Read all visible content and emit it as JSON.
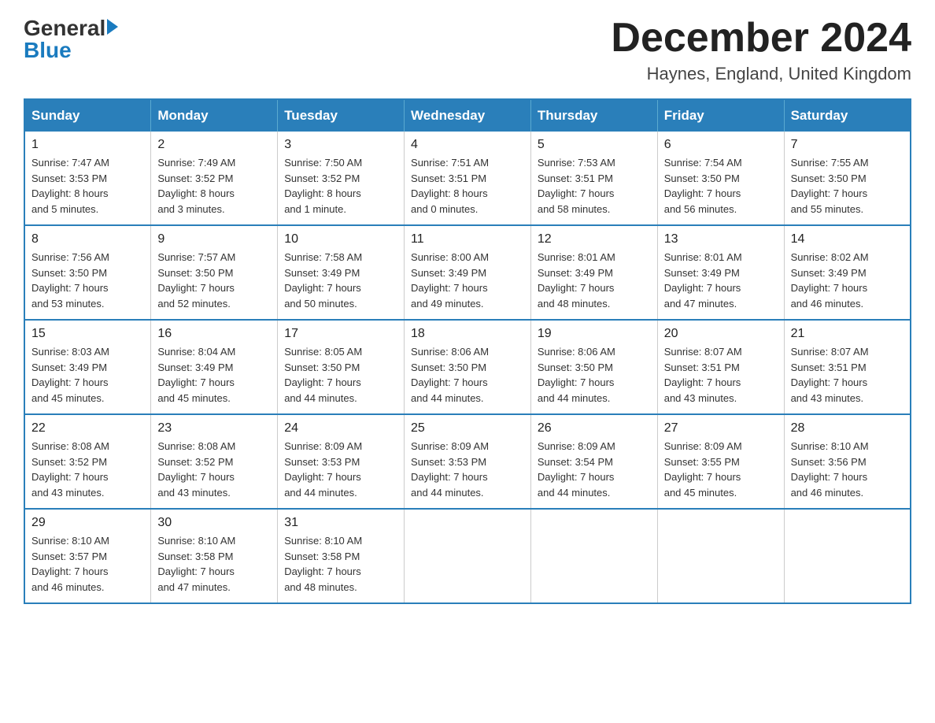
{
  "header": {
    "logo_general": "General",
    "logo_blue": "Blue",
    "month_title": "December 2024",
    "location": "Haynes, England, United Kingdom"
  },
  "days_of_week": [
    "Sunday",
    "Monday",
    "Tuesday",
    "Wednesday",
    "Thursday",
    "Friday",
    "Saturday"
  ],
  "weeks": [
    [
      {
        "day": "1",
        "info": "Sunrise: 7:47 AM\nSunset: 3:53 PM\nDaylight: 8 hours\nand 5 minutes."
      },
      {
        "day": "2",
        "info": "Sunrise: 7:49 AM\nSunset: 3:52 PM\nDaylight: 8 hours\nand 3 minutes."
      },
      {
        "day": "3",
        "info": "Sunrise: 7:50 AM\nSunset: 3:52 PM\nDaylight: 8 hours\nand 1 minute."
      },
      {
        "day": "4",
        "info": "Sunrise: 7:51 AM\nSunset: 3:51 PM\nDaylight: 8 hours\nand 0 minutes."
      },
      {
        "day": "5",
        "info": "Sunrise: 7:53 AM\nSunset: 3:51 PM\nDaylight: 7 hours\nand 58 minutes."
      },
      {
        "day": "6",
        "info": "Sunrise: 7:54 AM\nSunset: 3:50 PM\nDaylight: 7 hours\nand 56 minutes."
      },
      {
        "day": "7",
        "info": "Sunrise: 7:55 AM\nSunset: 3:50 PM\nDaylight: 7 hours\nand 55 minutes."
      }
    ],
    [
      {
        "day": "8",
        "info": "Sunrise: 7:56 AM\nSunset: 3:50 PM\nDaylight: 7 hours\nand 53 minutes."
      },
      {
        "day": "9",
        "info": "Sunrise: 7:57 AM\nSunset: 3:50 PM\nDaylight: 7 hours\nand 52 minutes."
      },
      {
        "day": "10",
        "info": "Sunrise: 7:58 AM\nSunset: 3:49 PM\nDaylight: 7 hours\nand 50 minutes."
      },
      {
        "day": "11",
        "info": "Sunrise: 8:00 AM\nSunset: 3:49 PM\nDaylight: 7 hours\nand 49 minutes."
      },
      {
        "day": "12",
        "info": "Sunrise: 8:01 AM\nSunset: 3:49 PM\nDaylight: 7 hours\nand 48 minutes."
      },
      {
        "day": "13",
        "info": "Sunrise: 8:01 AM\nSunset: 3:49 PM\nDaylight: 7 hours\nand 47 minutes."
      },
      {
        "day": "14",
        "info": "Sunrise: 8:02 AM\nSunset: 3:49 PM\nDaylight: 7 hours\nand 46 minutes."
      }
    ],
    [
      {
        "day": "15",
        "info": "Sunrise: 8:03 AM\nSunset: 3:49 PM\nDaylight: 7 hours\nand 45 minutes."
      },
      {
        "day": "16",
        "info": "Sunrise: 8:04 AM\nSunset: 3:49 PM\nDaylight: 7 hours\nand 45 minutes."
      },
      {
        "day": "17",
        "info": "Sunrise: 8:05 AM\nSunset: 3:50 PM\nDaylight: 7 hours\nand 44 minutes."
      },
      {
        "day": "18",
        "info": "Sunrise: 8:06 AM\nSunset: 3:50 PM\nDaylight: 7 hours\nand 44 minutes."
      },
      {
        "day": "19",
        "info": "Sunrise: 8:06 AM\nSunset: 3:50 PM\nDaylight: 7 hours\nand 44 minutes."
      },
      {
        "day": "20",
        "info": "Sunrise: 8:07 AM\nSunset: 3:51 PM\nDaylight: 7 hours\nand 43 minutes."
      },
      {
        "day": "21",
        "info": "Sunrise: 8:07 AM\nSunset: 3:51 PM\nDaylight: 7 hours\nand 43 minutes."
      }
    ],
    [
      {
        "day": "22",
        "info": "Sunrise: 8:08 AM\nSunset: 3:52 PM\nDaylight: 7 hours\nand 43 minutes."
      },
      {
        "day": "23",
        "info": "Sunrise: 8:08 AM\nSunset: 3:52 PM\nDaylight: 7 hours\nand 43 minutes."
      },
      {
        "day": "24",
        "info": "Sunrise: 8:09 AM\nSunset: 3:53 PM\nDaylight: 7 hours\nand 44 minutes."
      },
      {
        "day": "25",
        "info": "Sunrise: 8:09 AM\nSunset: 3:53 PM\nDaylight: 7 hours\nand 44 minutes."
      },
      {
        "day": "26",
        "info": "Sunrise: 8:09 AM\nSunset: 3:54 PM\nDaylight: 7 hours\nand 44 minutes."
      },
      {
        "day": "27",
        "info": "Sunrise: 8:09 AM\nSunset: 3:55 PM\nDaylight: 7 hours\nand 45 minutes."
      },
      {
        "day": "28",
        "info": "Sunrise: 8:10 AM\nSunset: 3:56 PM\nDaylight: 7 hours\nand 46 minutes."
      }
    ],
    [
      {
        "day": "29",
        "info": "Sunrise: 8:10 AM\nSunset: 3:57 PM\nDaylight: 7 hours\nand 46 minutes."
      },
      {
        "day": "30",
        "info": "Sunrise: 8:10 AM\nSunset: 3:58 PM\nDaylight: 7 hours\nand 47 minutes."
      },
      {
        "day": "31",
        "info": "Sunrise: 8:10 AM\nSunset: 3:58 PM\nDaylight: 7 hours\nand 48 minutes."
      },
      {
        "day": "",
        "info": ""
      },
      {
        "day": "",
        "info": ""
      },
      {
        "day": "",
        "info": ""
      },
      {
        "day": "",
        "info": ""
      }
    ]
  ]
}
